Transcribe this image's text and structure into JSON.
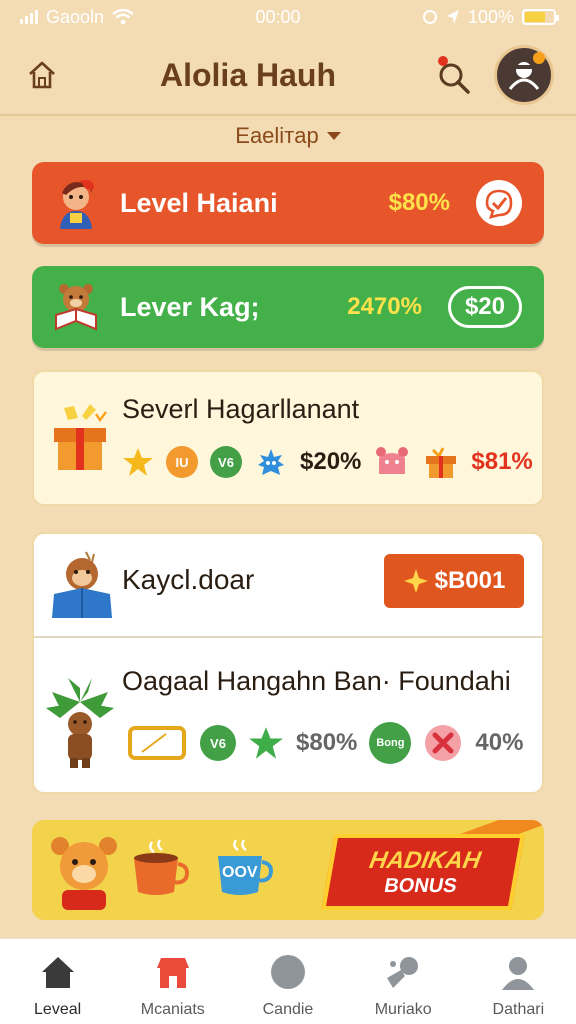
{
  "status_bar": {
    "carrier": "Gaooln",
    "time": "00:00",
    "battery": "100%"
  },
  "header": {
    "title": "Alolia Hauh",
    "home_icon": "home-icon",
    "search_icon": "search-icon",
    "avatar_icon": "avatar-icon"
  },
  "filter": {
    "label": "Eaeliтap"
  },
  "level_cards": [
    {
      "label": "Level Haiani",
      "value": "$80%",
      "action_icon": "check-icon",
      "color": "#e7552a"
    },
    {
      "label": "Lever Kag;",
      "value": "2470%",
      "action_label": "$20",
      "color": "#43b049"
    }
  ],
  "reward_card": {
    "title": "Severl Hagarllanant",
    "badges": [
      "IU",
      "V6"
    ],
    "pct1": "$20%",
    "pct2": "$81%"
  },
  "list_item_1": {
    "title": "Kaycl.doar",
    "price": "$B001"
  },
  "list_item_2": {
    "title": "Oagaal Hangahn Ban· Foundahi",
    "badge": "V6",
    "pct1": "$80%",
    "badge2": "Bong",
    "pct2": "40%"
  },
  "bonus_banner": {
    "line1": "HADIKAH",
    "line2": "BONUS",
    "cup_label": "OOV"
  },
  "bottom_nav": [
    {
      "label": "Leveal",
      "icon": "home-icon",
      "active": true
    },
    {
      "label": "Mcaniats",
      "icon": "shop-icon",
      "active": false
    },
    {
      "label": "Candie",
      "icon": "compass-icon",
      "active": false
    },
    {
      "label": "Muriako",
      "icon": "game-icon",
      "active": false
    },
    {
      "label": "Dathari",
      "icon": "profile-icon",
      "active": false
    }
  ]
}
